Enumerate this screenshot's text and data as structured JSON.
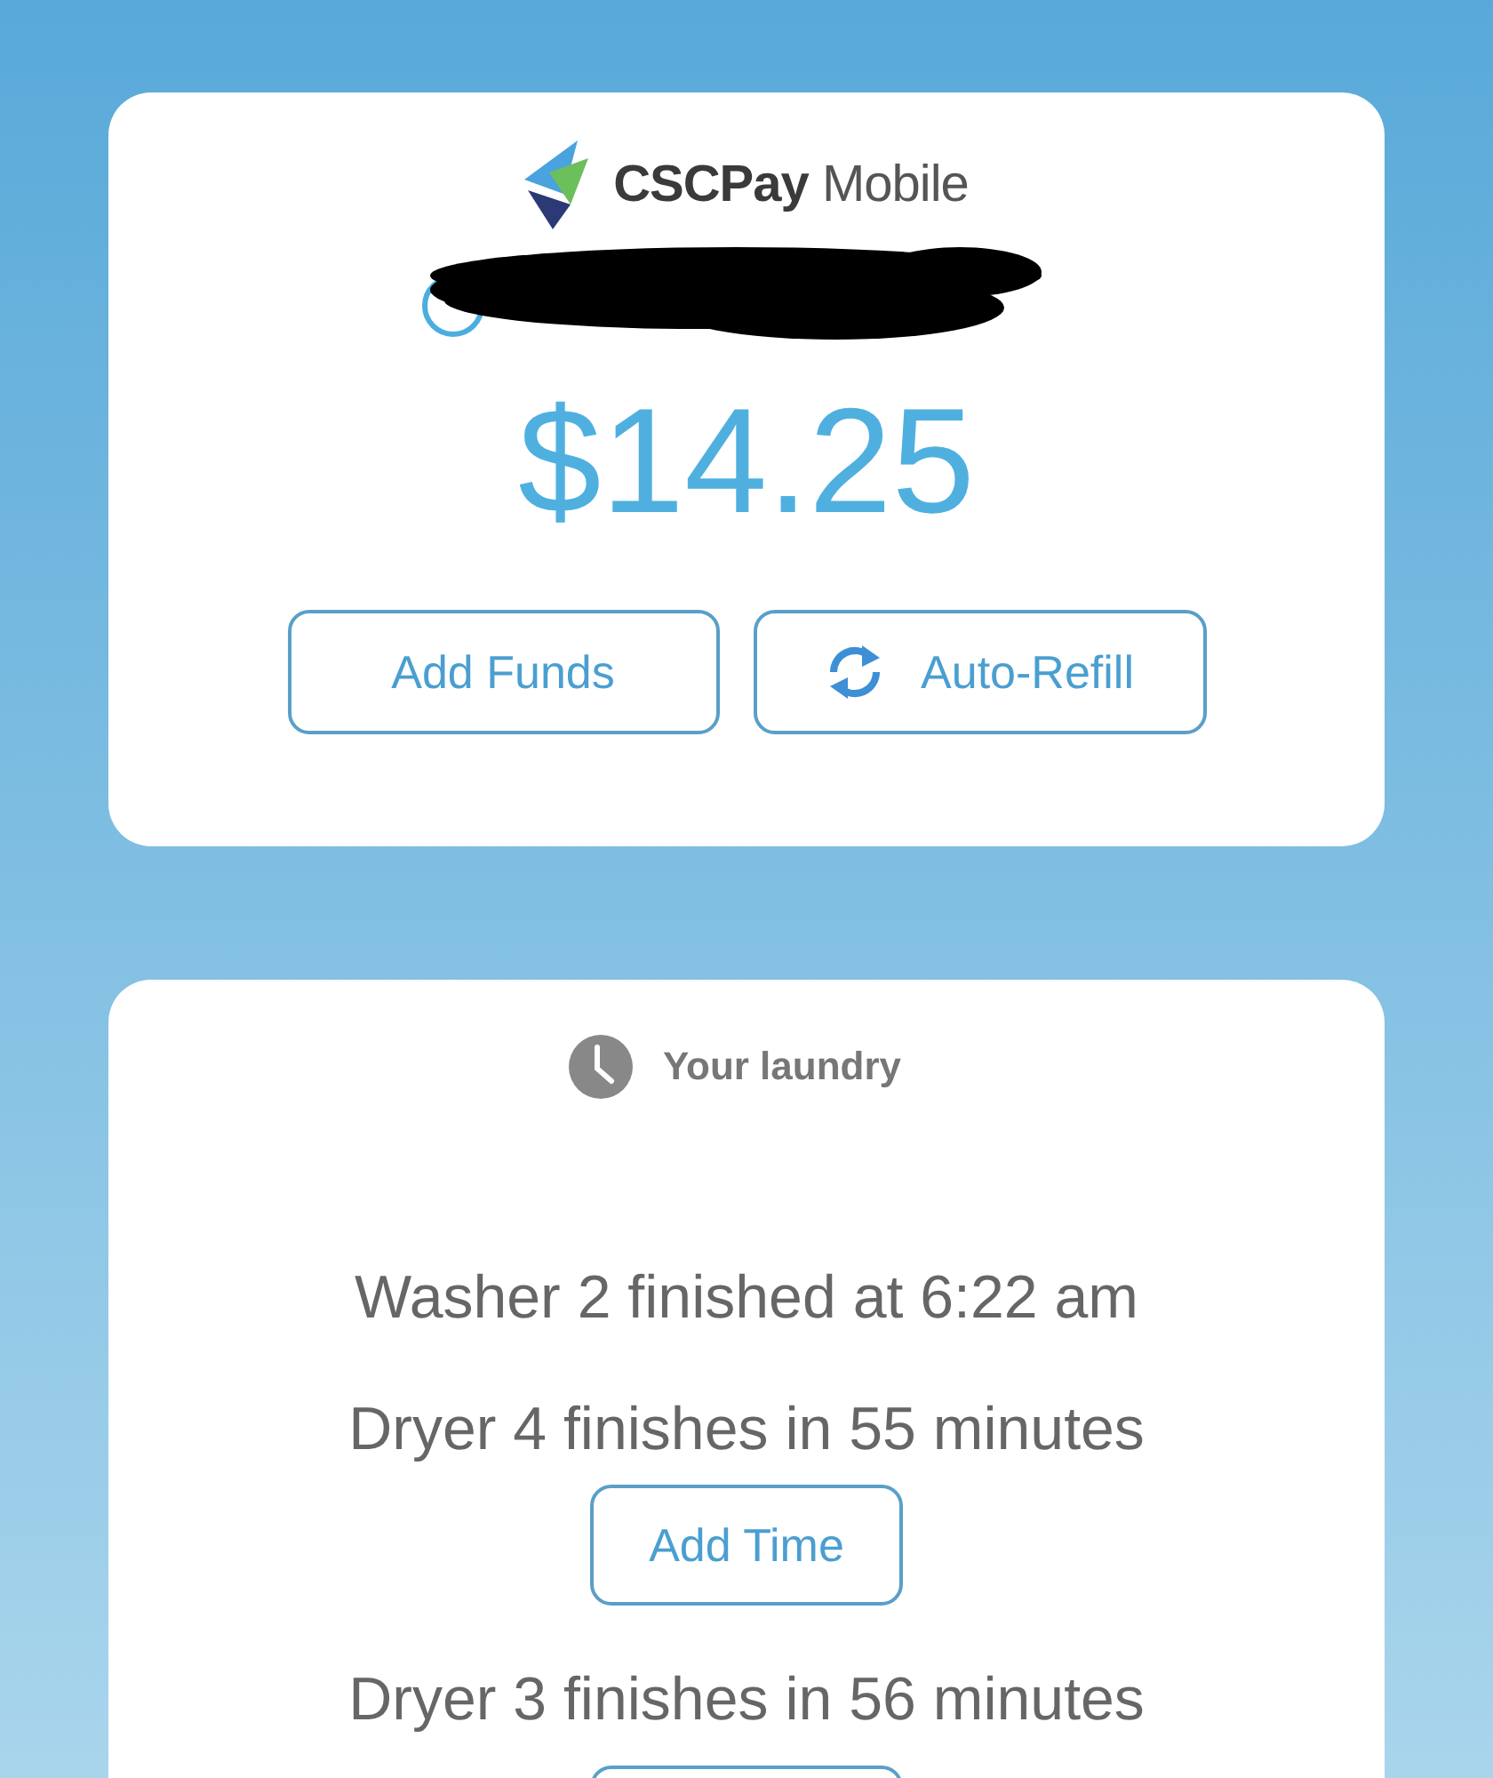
{
  "account": {
    "brand_bold": "CSCPay",
    "brand_light": "Mobile",
    "balance": "$14.25",
    "buttons": [
      {
        "label": "Add Funds",
        "kind": "plain"
      },
      {
        "label": "Auto-Refill",
        "kind": "refresh"
      }
    ]
  },
  "laundry": {
    "title": "Your laundry",
    "machines": [
      {
        "status": "Washer 2 finished at 6:22 am"
      },
      {
        "status": "Dryer 4 finishes in 55 minutes",
        "button": "Add Time"
      },
      {
        "status": "Dryer 3 finishes in 56 minutes",
        "button_cut": true
      }
    ]
  }
}
